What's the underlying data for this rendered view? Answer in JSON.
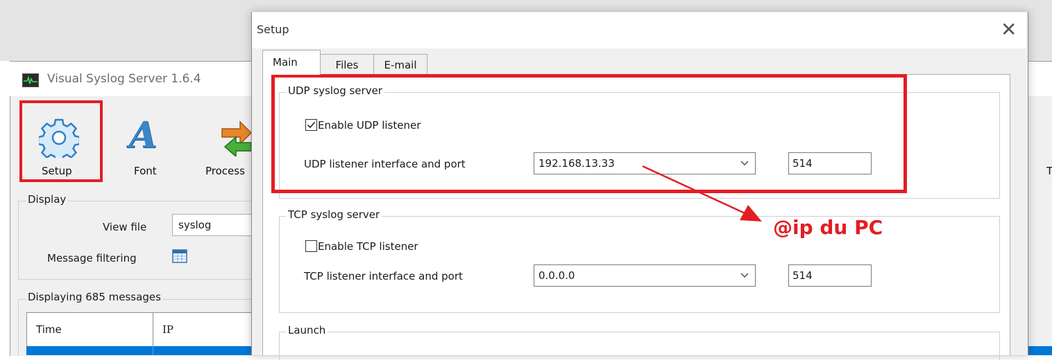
{
  "main_window": {
    "title": "Visual Syslog Server 1.6.4",
    "toolbar": {
      "setup_label": "Setup",
      "font_label": "Font",
      "process_label": "Process",
      "font_glyph": "A",
      "truncated_label": "T"
    },
    "display": {
      "legend": "Display",
      "view_file_label": "View file",
      "view_file_value": "syslog",
      "message_filtering_label": "Message filtering"
    },
    "messages": {
      "legend": "Displaying 685 messages",
      "columns": [
        "Time",
        "IP"
      ]
    }
  },
  "setup_dialog": {
    "title": "Setup",
    "close_glyph": "✕",
    "tabs": [
      "Main",
      "Files",
      "E-mail"
    ],
    "udp": {
      "legend": "UDP syslog server",
      "enable_label": "Enable UDP listener",
      "enabled": true,
      "interface_label": "UDP listener interface and port",
      "interface_value": "192.168.13.33",
      "port": "514"
    },
    "tcp": {
      "legend": "TCP syslog server",
      "enable_label": "Enable TCP listener",
      "enabled": false,
      "interface_label": "TCP listener interface and port",
      "interface_value": "0.0.0.0",
      "port": "514"
    },
    "launch": {
      "legend": "Launch"
    }
  },
  "annotation": {
    "text": "@ip du PC",
    "color": "#e31d24"
  },
  "colors": {
    "selection": "#0078d7",
    "highlight": "#e31d24",
    "icon_blue": "#3a86c8"
  }
}
